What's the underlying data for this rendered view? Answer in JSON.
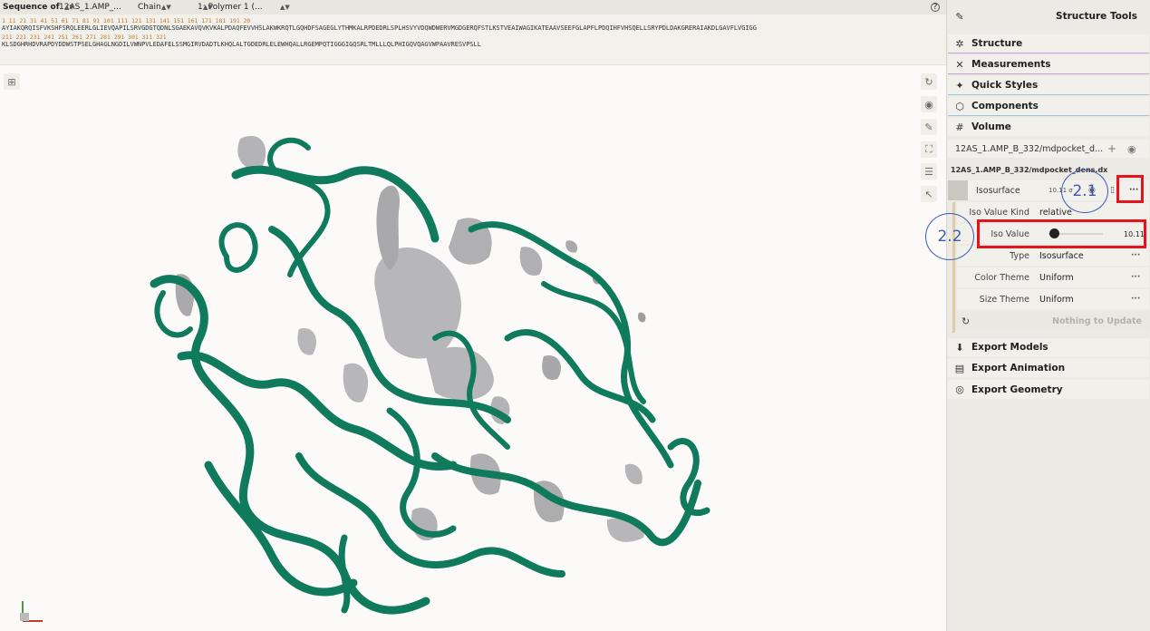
{
  "sequence_bar": {
    "label": "Sequence of",
    "entity": "12AS_1.AMP_...",
    "mode": "Chain",
    "chain": "1: Polymer 1 (...",
    "help_icon": "question-icon"
  },
  "sequence": {
    "nums1": "1         11        21        31        41        51        61        71        81        91        101       111       121       131       141       151       161       171       181       191       20",
    "line1": "AYIAKQRQISFVKSHFSRQLEERLGLIEVQAPILSRVGDGTQDNLSGAEKAVQVKVKALPDAQFEVVHSLAKWKRQTLGQHDFSAGEGLYTHMKALRPDEDRLSPLHSVYVDQWDWERVMGDGERQFSTLKSTVEAIWAGIKATEAAVSEEFGLAPFLPDQIHFVHSQELLSRYPDLDAKGRERAIAKDLGAVFLVGIGG",
    "nums2": "211       221       231       241       251       261       271       281       291       301       311       321",
    "line2": "KLSDGHRHDVRAPDYDDWSTPSELGHAGLNGDILVWNPVLEDAFELSSMGIRVDADTLKHQLALTGDEDRLELEWHQALLRGEMPQTIGGGIGQSRLTMLLLQLPHIGQVQAGVWPAAVRESVPSLL"
  },
  "viewport": {
    "protein_color": "#0f7a5c",
    "surface_color": "#b7b6b8"
  },
  "panel": {
    "title": "Structure Tools",
    "sections": {
      "structure": "Structure",
      "measurements": "Measurements",
      "quick_styles": "Quick Styles",
      "components": "Components",
      "volume": "Volume",
      "export_models": "Export Models",
      "export_animation": "Export Animation",
      "export_geometry": "Export Geometry"
    },
    "volume_select": "12AS_1.AMP_B_332/mdpocket_d...",
    "volume_file": "12AS_1.AMP_B_332/mdpocket_dens.dx",
    "iso": {
      "label": "Isosurface",
      "value_text": "10.11 σ",
      "kind_label": "Iso Value Kind",
      "kind_value": "relative",
      "iso_label": "Iso Value",
      "iso_value": "10.11",
      "slider_fraction": 0.1,
      "type_label": "Type",
      "type_value": "Isosurface",
      "color_label": "Color Theme",
      "color_value": "Uniform",
      "size_label": "Size Theme",
      "size_value": "Uniform",
      "update_label": "Nothing to Update"
    },
    "annotations": {
      "a1": "2.1",
      "a2": "2.2"
    }
  }
}
